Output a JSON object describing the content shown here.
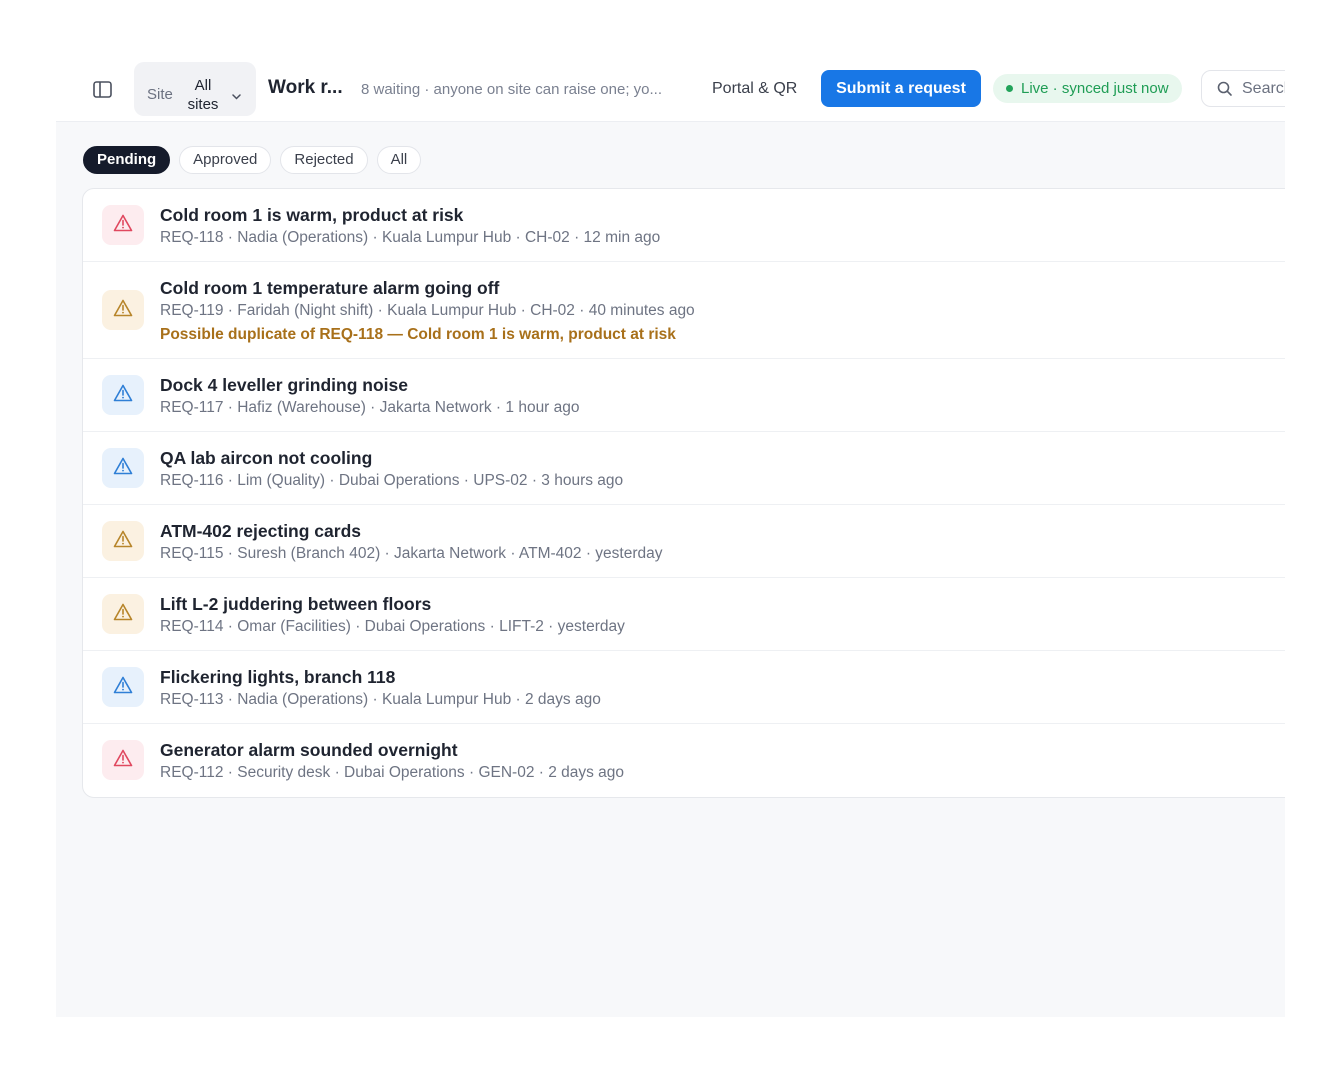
{
  "header": {
    "site_label": "Site",
    "site_value": "All sites",
    "title": "Work r...",
    "subtitle": "8 waiting · anyone on site can raise one; yo...",
    "portal_link": "Portal & QR",
    "submit_button": "Submit a request",
    "live_status": "Live · synced just now",
    "search_placeholder": "Search"
  },
  "tabs": [
    {
      "label": "Pending",
      "active": true
    },
    {
      "label": "Approved",
      "active": false
    },
    {
      "label": "Rejected",
      "active": false
    },
    {
      "label": "All",
      "active": false
    }
  ],
  "colors": {
    "accent": "#1877e6",
    "live": "#1f9d55",
    "severity_high": "#e0485f",
    "severity_medium": "#b7852a",
    "severity_low": "#2f7fd6",
    "duplicate_warning": "#a8701a"
  },
  "requests": [
    {
      "title": "Cold room 1 is warm, product at risk",
      "meta": "REQ-118 · Nadia (Operations) · Kuala Lumpur Hub · CH-02 · 12 min ago",
      "severity": "high",
      "icon": "warning-triangle-icon"
    },
    {
      "title": "Cold room 1 temperature alarm going off",
      "meta": "REQ-119 · Faridah (Night shift) · Kuala Lumpur Hub · CH-02 · 40 minutes ago",
      "duplicate_note": "Possible duplicate of REQ-118 — Cold room 1 is warm, product at risk",
      "severity": "medium",
      "icon": "warning-triangle-icon"
    },
    {
      "title": "Dock 4 leveller grinding noise",
      "meta": "REQ-117 · Hafiz (Warehouse) · Jakarta Network · 1 hour ago",
      "severity": "low",
      "icon": "warning-triangle-icon"
    },
    {
      "title": "QA lab aircon not cooling",
      "meta": "REQ-116 · Lim (Quality) · Dubai Operations · UPS-02 · 3 hours ago",
      "severity": "low",
      "icon": "warning-triangle-icon"
    },
    {
      "title": "ATM-402 rejecting cards",
      "meta": "REQ-115 · Suresh (Branch 402) · Jakarta Network · ATM-402 · yesterday",
      "severity": "medium",
      "icon": "warning-triangle-icon"
    },
    {
      "title": "Lift L-2 juddering between floors",
      "meta": "REQ-114 · Omar (Facilities) · Dubai Operations · LIFT-2 · yesterday",
      "severity": "medium",
      "icon": "warning-triangle-icon"
    },
    {
      "title": "Flickering lights, branch 118",
      "meta": "REQ-113 · Nadia (Operations) · Kuala Lumpur Hub · 2 days ago",
      "severity": "low",
      "icon": "warning-triangle-icon"
    },
    {
      "title": "Generator alarm sounded overnight",
      "meta": "REQ-112 · Security desk · Dubai Operations · GEN-02 · 2 days ago",
      "severity": "high",
      "icon": "warning-triangle-icon"
    }
  ]
}
